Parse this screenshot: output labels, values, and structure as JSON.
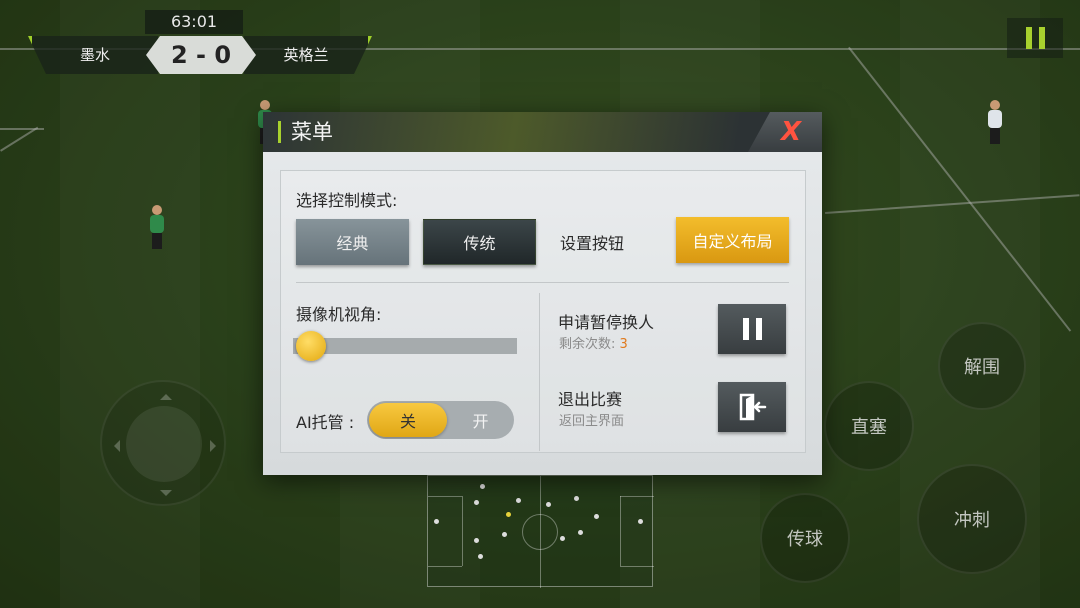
{
  "match": {
    "clock": "63:01",
    "home_team": "墨水",
    "score": "2 - 0",
    "away_team": "英格兰"
  },
  "controls": {
    "pause_icon": "pause-icon",
    "joystick_icon": "joystick-icon",
    "action_through_ball": "解围",
    "action_lob": "直塞",
    "action_pass": "传球",
    "action_sprint": "冲刺"
  },
  "menu": {
    "title": "菜单",
    "close_icon": "close-x-icon",
    "control_mode_label": "选择控制模式:",
    "mode_classic": "经典",
    "mode_traditional": "传统",
    "set_buttons_label": "设置按钮",
    "custom_layout": "自定义布局",
    "camera_label": "摄像机视角:",
    "camera_level": 0.03,
    "ai_label": "AI托管 :",
    "ai_off": "关",
    "ai_on": "开",
    "ai_state": "off",
    "substitution_label": "申请暂停换人",
    "remaining_label": "剩余次数:",
    "remaining_count": "3",
    "quit_label": "退出比赛",
    "quit_sub": "返回主界面",
    "quit_icon": "exit-door-icon"
  },
  "colors": {
    "accent_green": "#a8d12e",
    "accent_gold": "#e3a80e",
    "close_red": "#ff5340",
    "count_orange": "#e07a1d"
  }
}
